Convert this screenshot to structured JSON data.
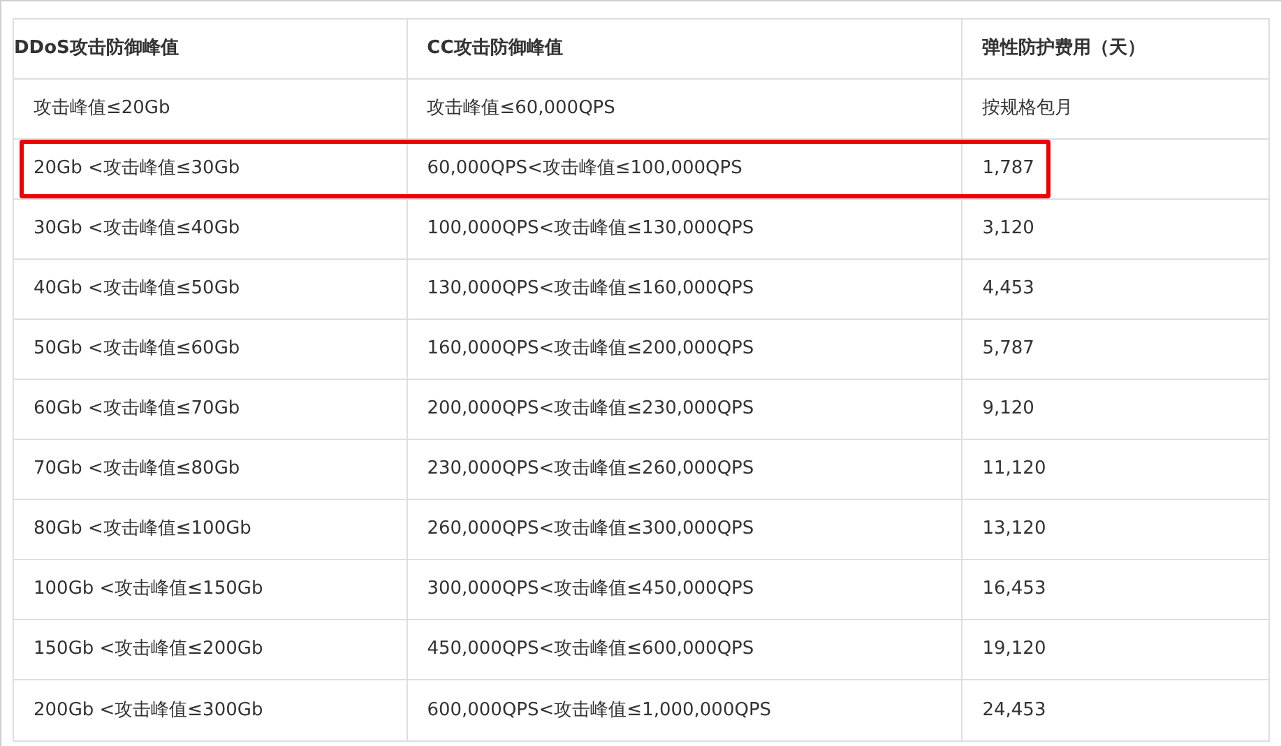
{
  "table": {
    "columns": [
      "DDoS攻击防御峰值",
      "CC攻击防御峰值",
      "弹性防护费用（天）"
    ],
    "rows": [
      {
        "cells": [
          "攻击峰值≤20Gb",
          "攻击峰值≤60,000QPS",
          "按规格包月"
        ],
        "highlighted": false
      },
      {
        "cells": [
          "20Gb <攻击峰值≤30Gb",
          "60,000QPS<攻击峰值≤100,000QPS",
          "1,787"
        ],
        "highlighted": true
      },
      {
        "cells": [
          "30Gb <攻击峰值≤40Gb",
          "100,000QPS<攻击峰值≤130,000QPS",
          "3,120"
        ],
        "highlighted": false
      },
      {
        "cells": [
          "40Gb <攻击峰值≤50Gb",
          "130,000QPS<攻击峰值≤160,000QPS",
          "4,453"
        ],
        "highlighted": false
      },
      {
        "cells": [
          "50Gb <攻击峰值≤60Gb",
          "160,000QPS<攻击峰值≤200,000QPS",
          "5,787"
        ],
        "highlighted": false
      },
      {
        "cells": [
          "60Gb <攻击峰值≤70Gb",
          "200,000QPS<攻击峰值≤230,000QPS",
          "9,120"
        ],
        "highlighted": false
      },
      {
        "cells": [
          "70Gb <攻击峰值≤80Gb",
          "230,000QPS<攻击峰值≤260,000QPS",
          "11,120"
        ],
        "highlighted": false
      },
      {
        "cells": [
          "80Gb <攻击峰值≤100Gb",
          "260,000QPS<攻击峰值≤300,000QPS",
          "13,120"
        ],
        "highlighted": false
      },
      {
        "cells": [
          "100Gb <攻击峰值≤150Gb",
          "300,000QPS<攻击峰值≤450,000QPS",
          "16,453"
        ],
        "highlighted": false
      },
      {
        "cells": [
          "150Gb <攻击峰值≤200Gb",
          "450,000QPS<攻击峰值≤600,000QPS",
          "19,120"
        ],
        "highlighted": false
      },
      {
        "cells": [
          "200Gb <攻击峰值≤300Gb",
          "600,000QPS<攻击峰值≤1,000,000QPS",
          "24,453"
        ],
        "highlighted": false
      }
    ]
  }
}
